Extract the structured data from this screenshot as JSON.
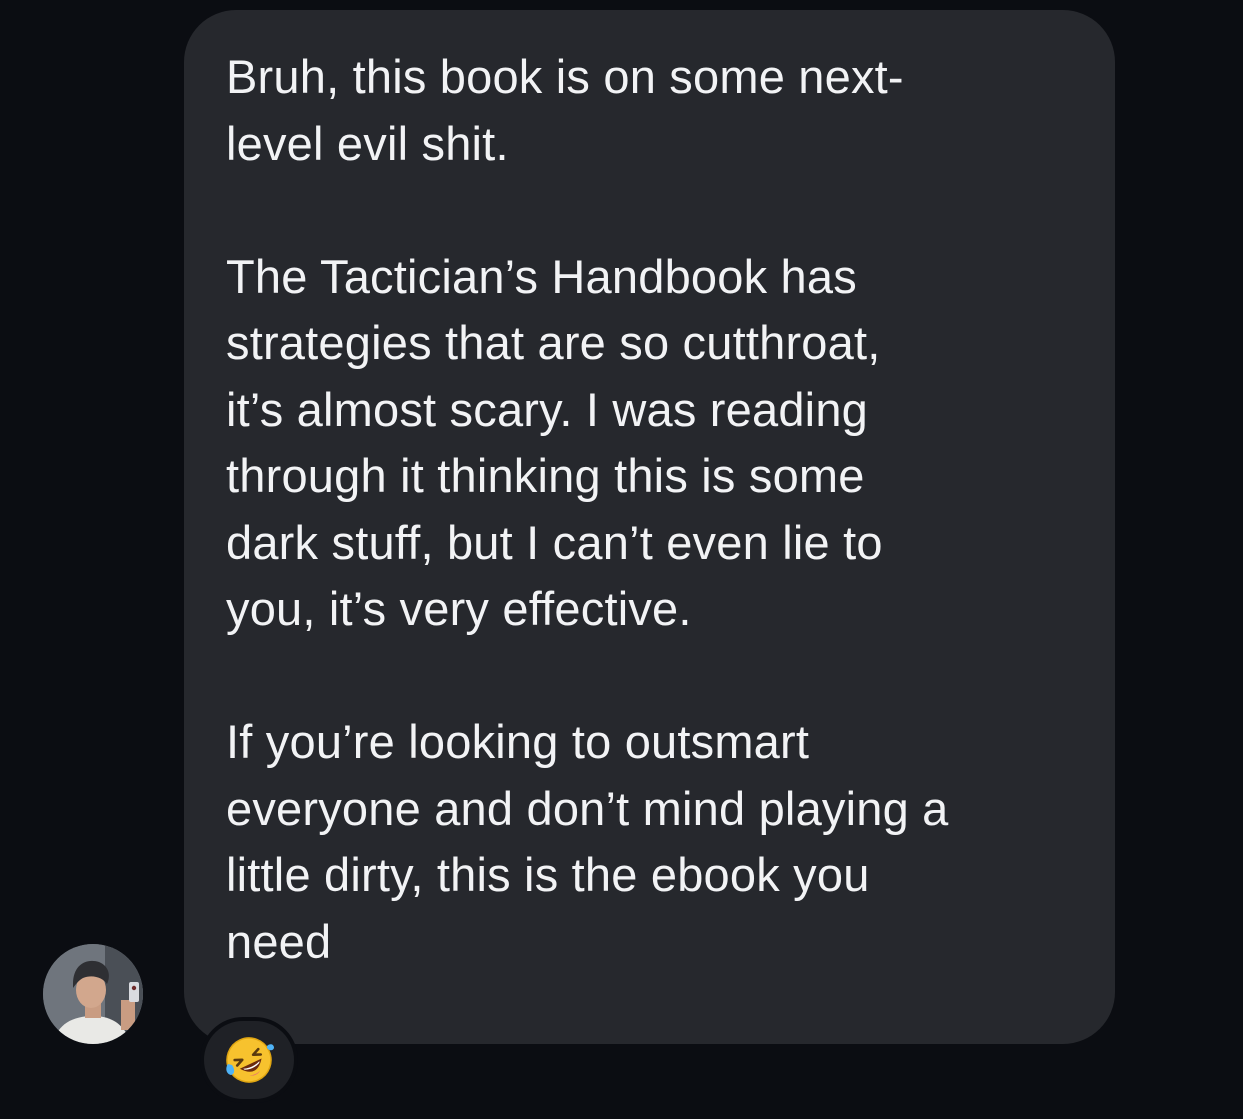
{
  "message": {
    "paragraphs": [
      [
        "Bruh, this book is on some next-",
        "level evil shit."
      ],
      [
        "The Tactician’s Handbook has",
        "strategies that are so cutthroat,",
        "it’s almost scary. I was reading",
        "through it thinking this is some",
        "dark stuff, but I can’t even lie to",
        "you, it’s very effective."
      ],
      [
        "If you’re looking to outsmart",
        "everyone and don’t mind playing a",
        "little dirty, this is the ebook you",
        "need"
      ]
    ]
  },
  "sender": {
    "avatar_icon": "user-avatar-photo"
  },
  "reaction": {
    "icon": "rolling-on-floor-laughing-emoji"
  },
  "colors": {
    "background": "#0b0d12",
    "bubble": "#26282d",
    "text": "#f2f3f5"
  }
}
